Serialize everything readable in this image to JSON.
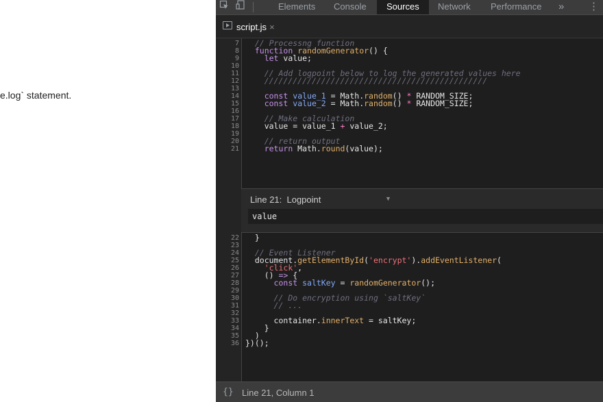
{
  "page": {
    "text": "e.log` statement."
  },
  "devtools": {
    "tabs": [
      "Elements",
      "Console",
      "Sources",
      "Network",
      "Performance"
    ],
    "active_tab": "Sources",
    "more_tabs_symbol": "»",
    "menu_symbol": "⋮",
    "file_tab": {
      "name": "script.js",
      "close_symbol": "×"
    }
  },
  "code": {
    "lines_before": [
      {
        "n": "7",
        "tokens": [
          {
            "t": "  "
          },
          {
            "t": "// Processng function",
            "c": "cm"
          }
        ]
      },
      {
        "n": "8",
        "tokens": [
          {
            "t": "  "
          },
          {
            "t": "function",
            "c": "kw"
          },
          {
            "t": " "
          },
          {
            "t": "randomGenerator",
            "c": "fn"
          },
          {
            "t": "() {"
          }
        ]
      },
      {
        "n": "9",
        "tokens": [
          {
            "t": "    "
          },
          {
            "t": "let",
            "c": "kw"
          },
          {
            "t": " value;"
          }
        ]
      },
      {
        "n": "10",
        "tokens": []
      },
      {
        "n": "11",
        "tokens": [
          {
            "t": "    "
          },
          {
            "t": "// Add logpoint below to log the generated values here",
            "c": "cm"
          }
        ]
      },
      {
        "n": "12",
        "tokens": [
          {
            "t": "    "
          },
          {
            "t": "///////////////////////////////////////////////",
            "c": "cm"
          }
        ]
      },
      {
        "n": "13",
        "tokens": []
      },
      {
        "n": "14",
        "tokens": [
          {
            "t": "    "
          },
          {
            "t": "const",
            "c": "kw"
          },
          {
            "t": " "
          },
          {
            "t": "value_1",
            "c": "va"
          },
          {
            "t": " = Math."
          },
          {
            "t": "random",
            "c": "fn"
          },
          {
            "t": "() "
          },
          {
            "t": "*",
            "c": "op"
          },
          {
            "t": " RANDOM_SIZE;"
          }
        ]
      },
      {
        "n": "15",
        "tokens": [
          {
            "t": "    "
          },
          {
            "t": "const",
            "c": "kw"
          },
          {
            "t": " "
          },
          {
            "t": "value_2",
            "c": "va"
          },
          {
            "t": " = Math."
          },
          {
            "t": "random",
            "c": "fn"
          },
          {
            "t": "() "
          },
          {
            "t": "*",
            "c": "op"
          },
          {
            "t": " RANDOM_SIZE;"
          }
        ]
      },
      {
        "n": "16",
        "tokens": []
      },
      {
        "n": "17",
        "tokens": [
          {
            "t": "    "
          },
          {
            "t": "// Make calculation",
            "c": "cm"
          }
        ]
      },
      {
        "n": "18",
        "tokens": [
          {
            "t": "    value = value_1 "
          },
          {
            "t": "+",
            "c": "op"
          },
          {
            "t": " value_2;"
          }
        ]
      },
      {
        "n": "19",
        "tokens": []
      },
      {
        "n": "20",
        "tokens": [
          {
            "t": "    "
          },
          {
            "t": "// return output",
            "c": "cm"
          }
        ]
      },
      {
        "n": "21",
        "tokens": [
          {
            "t": "    "
          },
          {
            "t": "return",
            "c": "kw"
          },
          {
            "t": " Math."
          },
          {
            "t": "round",
            "c": "fn"
          },
          {
            "t": "(value);"
          }
        ]
      }
    ],
    "lines_after": [
      {
        "n": "22",
        "tokens": [
          {
            "t": "  }"
          }
        ]
      },
      {
        "n": "23",
        "tokens": []
      },
      {
        "n": "24",
        "tokens": [
          {
            "t": "  "
          },
          {
            "t": "// Event Listener",
            "c": "cm"
          }
        ]
      },
      {
        "n": "25",
        "tokens": [
          {
            "t": "  document."
          },
          {
            "t": "getElementById",
            "c": "fn"
          },
          {
            "t": "("
          },
          {
            "t": "'encrypt'",
            "c": "str"
          },
          {
            "t": ")."
          },
          {
            "t": "addEventListener",
            "c": "fn"
          },
          {
            "t": "("
          }
        ]
      },
      {
        "n": "26",
        "tokens": [
          {
            "t": "    "
          },
          {
            "t": "'click'",
            "c": "str"
          },
          {
            "t": ","
          }
        ]
      },
      {
        "n": "27",
        "tokens": [
          {
            "t": "    () "
          },
          {
            "t": "=>",
            "c": "kw"
          },
          {
            "t": " {"
          }
        ]
      },
      {
        "n": "28",
        "tokens": [
          {
            "t": "      "
          },
          {
            "t": "const",
            "c": "kw"
          },
          {
            "t": " "
          },
          {
            "t": "saltKey",
            "c": "va"
          },
          {
            "t": " = "
          },
          {
            "t": "randomGenerator",
            "c": "fn"
          },
          {
            "t": "();"
          }
        ]
      },
      {
        "n": "29",
        "tokens": []
      },
      {
        "n": "30",
        "tokens": [
          {
            "t": "      "
          },
          {
            "t": "// Do encryption using `saltKey`",
            "c": "cm"
          }
        ]
      },
      {
        "n": "31",
        "tokens": [
          {
            "t": "      "
          },
          {
            "t": "// ...",
            "c": "cm"
          }
        ]
      },
      {
        "n": "32",
        "tokens": []
      },
      {
        "n": "33",
        "tokens": [
          {
            "t": "      container."
          },
          {
            "t": "innerText",
            "c": "fn"
          },
          {
            "t": " = saltKey;"
          }
        ]
      },
      {
        "n": "34",
        "tokens": [
          {
            "t": "    }"
          }
        ]
      },
      {
        "n": "35",
        "tokens": [
          {
            "t": "  )"
          }
        ]
      },
      {
        "n": "36",
        "tokens": [
          {
            "t": "})();"
          }
        ]
      }
    ]
  },
  "logpoint": {
    "title": "Line 21:  Logpoint",
    "value": "value"
  },
  "statusbar": {
    "icon": "{}",
    "position": "Line 21, Column 1"
  }
}
